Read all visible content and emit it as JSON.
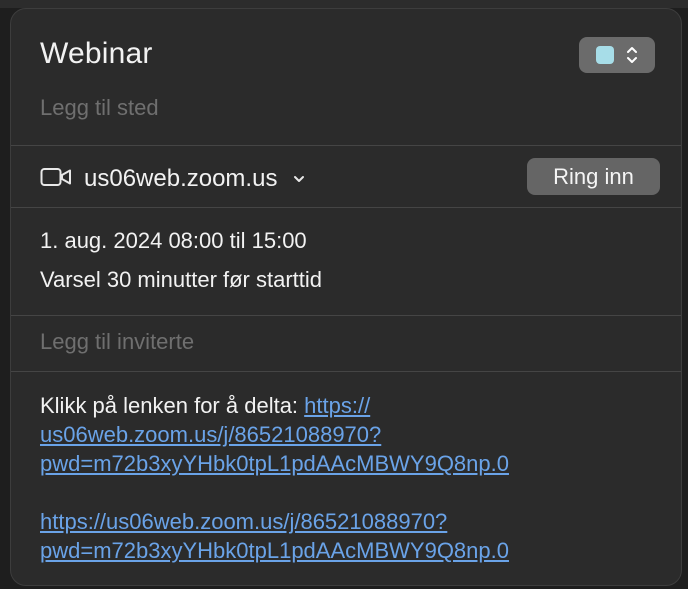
{
  "event": {
    "title": "Webinar",
    "location_placeholder": "Legg til sted",
    "calendar_color": "#a7dde8"
  },
  "video": {
    "host": "us06web.zoom.us",
    "ring_button_label": "Ring inn"
  },
  "schedule": {
    "datetime": "1. aug. 2024 08:00 til 15:00",
    "alert": "Varsel 30 minutter før starttid"
  },
  "invitees": {
    "placeholder": "Legg til inviterte"
  },
  "notes": {
    "intro": "Klikk på lenken for å delta: ",
    "link_1_line1": "https://",
    "link_1_line2": "us06web.zoom.us/j/86521088970?",
    "link_1_line3": "pwd=m72b3xyYHbk0tpL1pdAAcMBWY9Q8np.0",
    "link_2_line1": "https://us06web.zoom.us/j/86521088970?",
    "link_2_line2": "pwd=m72b3xyYHbk0tpL1pdAAcMBWY9Q8np.0"
  }
}
